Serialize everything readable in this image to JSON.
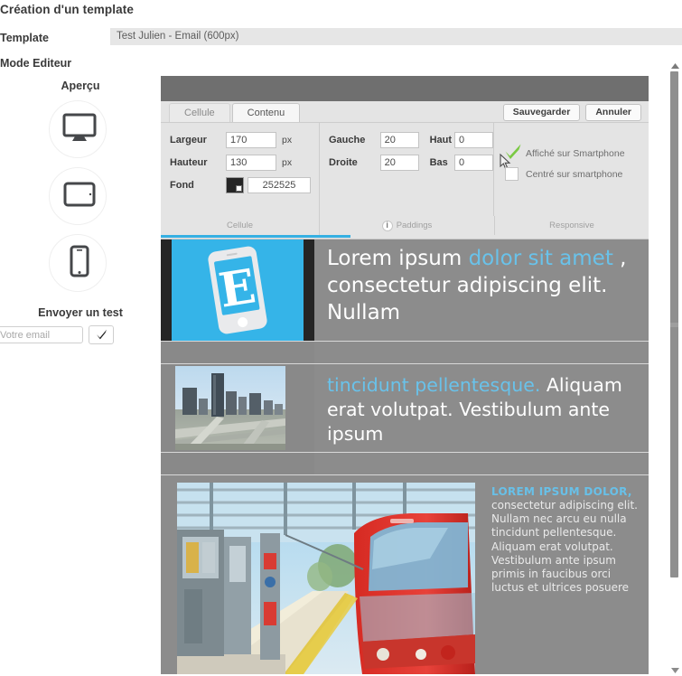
{
  "page": {
    "title": "Création d'un template"
  },
  "form": {
    "template_label": "Template",
    "template_value": "Test Julien - Email (600px)",
    "mode_label": "Mode Editeur"
  },
  "sidebar": {
    "preview_heading": "Aperçu",
    "devices": [
      {
        "name": "desktop",
        "icon": "desktop-icon"
      },
      {
        "name": "tablet",
        "icon": "tablet-icon"
      },
      {
        "name": "mobile",
        "icon": "mobile-icon"
      }
    ],
    "send_test_heading": "Envoyer un test",
    "email_placeholder": "Votre email",
    "email_value": "",
    "submit_icon": "check-icon"
  },
  "toolbar": {
    "tabs": [
      {
        "label": "Cellule",
        "active": true
      },
      {
        "label": "Contenu",
        "active": false
      }
    ],
    "save_label": "Sauvegarder",
    "cancel_label": "Annuler",
    "cellule": {
      "footer_label": "Cellule",
      "largeur_label": "Largeur",
      "largeur_value": "170",
      "largeur_unit": "px",
      "hauteur_label": "Hauteur",
      "hauteur_value": "130",
      "hauteur_unit": "px",
      "fond_label": "Fond",
      "fond_color": "#252525",
      "fond_hex": "252525"
    },
    "paddings": {
      "footer_label": "Paddings",
      "info_icon": "info-icon",
      "gauche_label": "Gauche",
      "gauche_value": "20",
      "haut_label": "Haut",
      "haut_value": "0",
      "droite_label": "Droite",
      "droite_value": "20",
      "bas_label": "Bas",
      "bas_value": "0"
    },
    "responsive": {
      "footer_label": "Responsive",
      "affiche_label": "Affiché sur Smartphone",
      "affiche_checked": true,
      "centre_label": "Centré sur smartphone",
      "centre_checked": false,
      "check_color": "#7ac943"
    }
  },
  "email": {
    "accent_color": "#69c2ea",
    "background_color": "#8c8c8c",
    "block1": {
      "cell_background": "#252525",
      "logo_background": "#35b4e8",
      "logo_icon": "email-phone-logo-icon",
      "text_part1": "Lorem ipsum ",
      "text_accent": "dolor sit amet",
      "text_part2": " , consectetur adipiscing elit. Nullam"
    },
    "block2": {
      "image_name": "city-skyline-highway-photo",
      "text_accent": "tincidunt pellentesque.",
      "text_rest": "Aliquam erat volutpat. Vestibulum ante ipsum"
    },
    "block3": {
      "image_name": "red-tram-station-photo",
      "heading": "LOREM IPSUM DOLOR,",
      "body": "consectetur adipiscing elit. Nullam nec arcu eu nulla tincidunt pellentesque. Aliquam erat volutpat. Vestibulum ante ipsum primis in faucibus orci luctus et ultrices posuere"
    }
  },
  "scrollbar": {
    "up_icon": "chevron-up-icon",
    "down_icon": "chevron-down-icon"
  }
}
